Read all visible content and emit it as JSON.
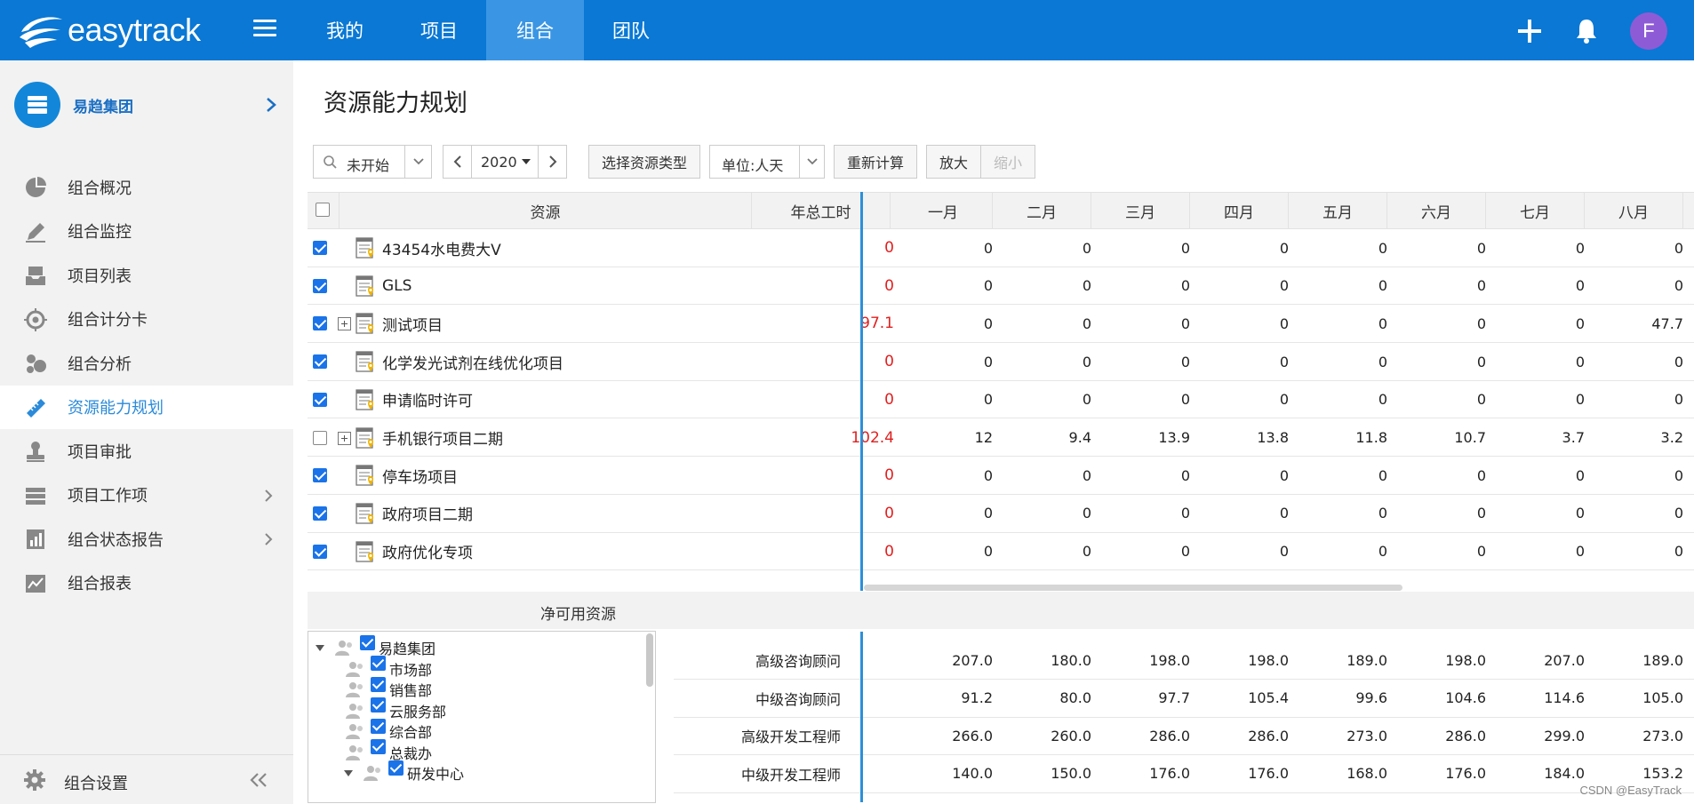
{
  "app": {
    "logo_text": "easytrack",
    "nav": [
      "我的",
      "项目",
      "组合",
      "团队"
    ],
    "active_nav": "组合",
    "avatar_letter": "F",
    "brand_color": "#0a78d4"
  },
  "sidebar": {
    "org_name": "易趋集团",
    "items": [
      {
        "label": "组合概况",
        "icon": "pie-chart-icon"
      },
      {
        "label": "组合监控",
        "icon": "pen-icon"
      },
      {
        "label": "项目列表",
        "icon": "inbox-icon"
      },
      {
        "label": "组合计分卡",
        "icon": "target-icon"
      },
      {
        "label": "组合分析",
        "icon": "bubbles-icon"
      },
      {
        "label": "资源能力规划",
        "icon": "ruler-icon",
        "active": true
      },
      {
        "label": "项目审批",
        "icon": "stamp-icon"
      },
      {
        "label": "项目工作项",
        "icon": "stack-icon",
        "chevron": true
      },
      {
        "label": "组合状态报告",
        "icon": "report-icon",
        "chevron": true
      },
      {
        "label": "组合报表",
        "icon": "chart-icon"
      }
    ],
    "footer_label": "组合设置"
  },
  "main": {
    "title": "资源能力规划",
    "toolbar": {
      "status_filter": "未开始",
      "year": "2020",
      "resource_type_button": "选择资源类型",
      "unit": "单位:人天",
      "recalc_button": "重新计算",
      "zoom_in": "放大",
      "zoom_out": "缩小"
    },
    "grid": {
      "headers": {
        "resource": "资源",
        "hours": "年总工时"
      },
      "months": [
        "一月",
        "二月",
        "三月",
        "四月",
        "五月",
        "六月",
        "七月",
        "八月"
      ],
      "rows": [
        {
          "name": "43454水电费大V",
          "checked": true,
          "expandable": false,
          "hours": "0",
          "values": [
            "0",
            "0",
            "0",
            "0",
            "0",
            "0",
            "0",
            "0"
          ]
        },
        {
          "name": "GLS",
          "checked": true,
          "expandable": false,
          "hours": "0",
          "values": [
            "0",
            "0",
            "0",
            "0",
            "0",
            "0",
            "0",
            "0"
          ]
        },
        {
          "name": "测试项目",
          "checked": true,
          "expandable": true,
          "hours": "97.1",
          "values": [
            "0",
            "0",
            "0",
            "0",
            "0",
            "0",
            "0",
            "47.7"
          ]
        },
        {
          "name": "化学发光试剂在线优化项目",
          "checked": true,
          "expandable": false,
          "hours": "0",
          "values": [
            "0",
            "0",
            "0",
            "0",
            "0",
            "0",
            "0",
            "0"
          ]
        },
        {
          "name": "申请临时许可",
          "checked": true,
          "expandable": false,
          "hours": "0",
          "values": [
            "0",
            "0",
            "0",
            "0",
            "0",
            "0",
            "0",
            "0"
          ]
        },
        {
          "name": "手机银行项目二期",
          "checked": false,
          "expandable": true,
          "hours": "102.4",
          "values": [
            "12",
            "9.4",
            "13.9",
            "13.8",
            "11.8",
            "10.7",
            "3.7",
            "3.2"
          ]
        },
        {
          "name": "停车场项目",
          "checked": true,
          "expandable": false,
          "hours": "0",
          "values": [
            "0",
            "0",
            "0",
            "0",
            "0",
            "0",
            "0",
            "0"
          ]
        },
        {
          "name": "政府项目二期",
          "checked": true,
          "expandable": false,
          "hours": "0",
          "values": [
            "0",
            "0",
            "0",
            "0",
            "0",
            "0",
            "0",
            "0"
          ]
        },
        {
          "name": "政府优化专项",
          "checked": true,
          "expandable": false,
          "hours": "0",
          "values": [
            "0",
            "0",
            "0",
            "0",
            "0",
            "0",
            "0",
            "0"
          ]
        }
      ]
    },
    "net_available": {
      "title": "净可用资源",
      "tree": [
        {
          "label": "易趋集团",
          "level": 0,
          "arrow": true
        },
        {
          "label": "市场部",
          "level": 1
        },
        {
          "label": "销售部",
          "level": 1
        },
        {
          "label": "云服务部",
          "level": 1
        },
        {
          "label": "综合部",
          "level": 1
        },
        {
          "label": "总裁办",
          "level": 1
        },
        {
          "label": "研发中心",
          "level": 1,
          "arrow": true
        }
      ],
      "roles": [
        {
          "name": "高级咨询顾问",
          "values": [
            "207.0",
            "180.0",
            "198.0",
            "198.0",
            "189.0",
            "198.0",
            "207.0",
            "189.0"
          ]
        },
        {
          "name": "中级咨询顾问",
          "values": [
            "91.2",
            "80.0",
            "97.7",
            "105.4",
            "99.6",
            "104.6",
            "114.6",
            "105.0"
          ]
        },
        {
          "name": "高级开发工程师",
          "values": [
            "266.0",
            "260.0",
            "286.0",
            "286.0",
            "273.0",
            "286.0",
            "299.0",
            "273.0"
          ]
        },
        {
          "name": "中级开发工程师",
          "values": [
            "140.0",
            "150.0",
            "176.0",
            "176.0",
            "168.0",
            "176.0",
            "184.0",
            "153.2"
          ]
        }
      ]
    }
  },
  "watermark": "CSDN @EasyTrack"
}
